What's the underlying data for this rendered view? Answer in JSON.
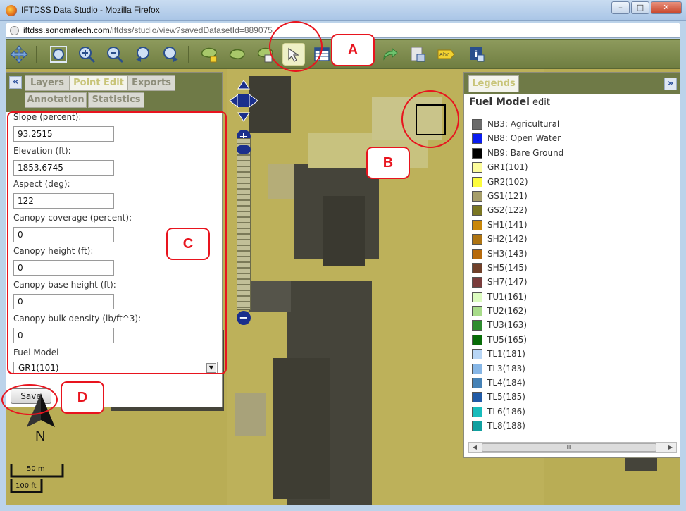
{
  "window": {
    "title": "IFTDSS Data Studio - Mozilla Firefox",
    "minimize_label": "–",
    "maximize_label": "□",
    "close_label": "✕"
  },
  "address_bar": {
    "domain": "iftdss.sonomatech.com",
    "path": "/iftdss/studio/view?savedDatasetId=889075"
  },
  "toolbar": {
    "icons": [
      "pan-icon",
      "zoom-extent-icon",
      "zoom-in-icon",
      "zoom-out-icon",
      "zoom-previous-icon",
      "zoom-next-icon",
      "add-polygon-icon",
      "edit-polygon-icon",
      "identify-polygon-icon",
      "select-arrow-icon",
      "table-icon",
      "redo-icon",
      "export-icon",
      "label-icon",
      "info-icon"
    ],
    "label_icon_text": "abc",
    "active_tool": "select-arrow-icon"
  },
  "left_panel": {
    "collapse_label": "«",
    "tabs": [
      {
        "label": "Layers",
        "active": false
      },
      {
        "label": "Point Edit",
        "active": true
      },
      {
        "label": "Exports",
        "active": false
      },
      {
        "label": "Annotation",
        "active": false
      },
      {
        "label": "Statistics",
        "active": false
      }
    ],
    "fields": [
      {
        "label": "Slope (percent):",
        "value": "93.2515"
      },
      {
        "label": "Elevation (ft):",
        "value": "1853.6745"
      },
      {
        "label": "Aspect (deg):",
        "value": "122"
      },
      {
        "label": "Canopy coverage (percent):",
        "value": "0"
      },
      {
        "label": "Canopy height (ft):",
        "value": "0"
      },
      {
        "label": "Canopy base height (ft):",
        "value": "0"
      },
      {
        "label": "Canopy bulk density (lb/ft^3):",
        "value": "0"
      }
    ],
    "fuel_model": {
      "label": "Fuel Model",
      "selected": "GR1(101)"
    },
    "save_label": "Save"
  },
  "map": {
    "zoom_in_label": "+",
    "zoom_out_label": "−",
    "north_label": "N",
    "scale_m": "50 m",
    "scale_ft": "100 ft"
  },
  "legend": {
    "tab_label": "Legends",
    "expand_label": "»",
    "title": "Fuel Model",
    "edit_label": "edit",
    "items": [
      {
        "label": "NB3: Agricultural",
        "color": "#6b6b6b"
      },
      {
        "label": "NB8: Open Water",
        "color": "#0a1cf0"
      },
      {
        "label": "NB9: Bare Ground",
        "color": "#000000"
      },
      {
        "label": "GR1(101)",
        "color": "#fcfc9c"
      },
      {
        "label": "GR2(102)",
        "color": "#fcfc3c"
      },
      {
        "label": "GS1(121)",
        "color": "#a69e6a"
      },
      {
        "label": "GS2(122)",
        "color": "#7a7622"
      },
      {
        "label": "SH1(141)",
        "color": "#c9870a"
      },
      {
        "label": "SH2(142)",
        "color": "#ae7412"
      },
      {
        "label": "SH3(143)",
        "color": "#b66a0c"
      },
      {
        "label": "SH5(145)",
        "color": "#70402a"
      },
      {
        "label": "SH7(147)",
        "color": "#7a3c3c"
      },
      {
        "label": "TU1(161)",
        "color": "#dcfcc0"
      },
      {
        "label": "TU2(162)",
        "color": "#a8dc8a"
      },
      {
        "label": "TU3(163)",
        "color": "#2e8c2e"
      },
      {
        "label": "TU5(165)",
        "color": "#086c08"
      },
      {
        "label": "TL1(181)",
        "color": "#b8d6f6"
      },
      {
        "label": "TL3(183)",
        "color": "#86b6e6"
      },
      {
        "label": "TL4(184)",
        "color": "#4682b6"
      },
      {
        "label": "TL5(185)",
        "color": "#205aa6"
      },
      {
        "label": "TL6(186)",
        "color": "#18bcbc"
      },
      {
        "label": "TL8(188)",
        "color": "#10a0a0"
      }
    ],
    "scroll_grip": "III"
  },
  "annotations": {
    "a": "A",
    "b": "B",
    "c": "C",
    "d": "D",
    "color": "#e8141e"
  }
}
